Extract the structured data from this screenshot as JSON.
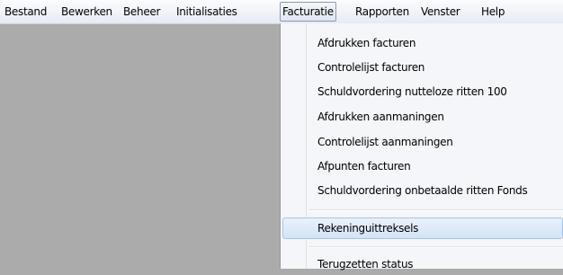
{
  "menubar": {
    "items": [
      {
        "label": "Bestand"
      },
      {
        "label": "Bewerken"
      },
      {
        "label": "Beheer"
      },
      {
        "label": "Initialisaties"
      },
      {
        "label": "Facturatie"
      },
      {
        "label": "Rapporten"
      },
      {
        "label": "Venster"
      },
      {
        "label": "Help"
      }
    ],
    "active": "Facturatie"
  },
  "facturatie_menu": {
    "items": [
      {
        "label": "Afdrukken facturen"
      },
      {
        "label": "Controlelijst facturen"
      },
      {
        "label": "Schuldvordering nutteloze ritten 100"
      },
      {
        "label": "Afdrukken aanmaningen"
      },
      {
        "label": "Controlelijst aanmaningen"
      },
      {
        "label": "Afpunten facturen"
      },
      {
        "label": "Schuldvordering onbetaalde ritten Fonds"
      },
      {
        "label": "Rekeninguittreksels"
      },
      {
        "label": "Terugzetten status"
      }
    ],
    "highlighted": "Rekeninguittreksels"
  }
}
